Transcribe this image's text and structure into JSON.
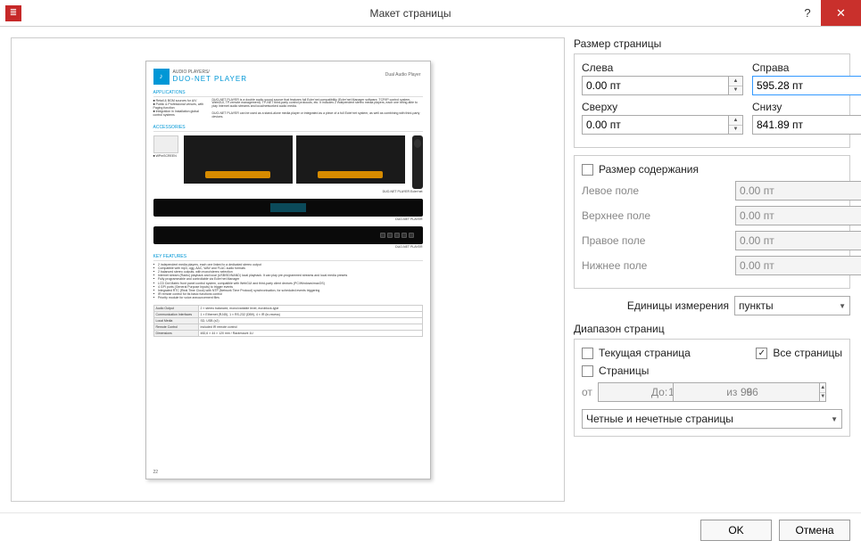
{
  "window": {
    "title": "Макет страницы"
  },
  "page_size": {
    "group_title": "Размер страницы",
    "left_label": "Слева",
    "left_value": "0.00 пт",
    "right_label": "Справа",
    "right_value": "595.28 пт",
    "top_label": "Сверху",
    "top_value": "0.00 пт",
    "bottom_label": "Снизу",
    "bottom_value": "841.89 пт"
  },
  "content_size": {
    "checkbox_label": "Размер содержания",
    "left_margin_label": "Левое поле",
    "left_margin_value": "0.00 пт",
    "top_margin_label": "Верхнее поле",
    "top_margin_value": "0.00 пт",
    "right_margin_label": "Правое поле",
    "right_margin_value": "0.00 пт",
    "bottom_margin_label": "Нижнее поле",
    "bottom_margin_value": "0.00 пт"
  },
  "units": {
    "label": "Единицы измерения",
    "value": "пункты"
  },
  "page_range": {
    "group_title": "Диапазон страниц",
    "current_label": "Текущая страница",
    "all_label": "Все страницы",
    "pages_label": "Страницы",
    "from_label": "от",
    "from_value": "1",
    "to_label": "До:",
    "to_value": "96",
    "of_label": "из : 96",
    "parity_value": "Четные и нечетные страницы"
  },
  "buttons": {
    "ok": "OK",
    "cancel": "Отмена"
  },
  "preview": {
    "category": "AUDIO PLAYERS/",
    "title": "DUO-NET PLAYER",
    "subtitle": "Dual Audio Player",
    "section_applications": "APPLICATIONS",
    "app_bullets": "■ Retail & BGM sources for A/V\n■ Public & Professional venues, with Paging function\n■ Integration in Installation global control systems",
    "app_para": "DUO-NET PLAYER is a double audio sound source that features full Ecler'net compatibility (Ecler'net Manager software, TCP/IP control system, WebGUI, TP-remote management). TP-NET third-party control protocols, etc. It includes 2 independent stereo media players, each one being able to play Internet audio streams and local/networked audio media.\n\nDUO-NET PLAYER can be used as a stand-alone media player or integrated as a piece of a full Ecler'net system, as well as combining with third-party devices.",
    "section_accessories": "ACCESSORIES",
    "accessory_model": "■ WPmSCREEN",
    "caption1": "DUO-NET PLAYER Ecler'net",
    "caption2": "DUO-NET PLAYER",
    "caption3": "DUO-NET PLAYER",
    "section_features": "KEY FEATURES",
    "features": [
      "2 independent media players, each one linked to a dedicated stereo output",
      "Compatible with mp3, ogg, AAC, WAV and FLAC audio formats",
      "2 balanced stereo outputs, with mono/stereo selection",
      "Internet stream (Radio) playback and local (USB/SD/NAND) local playback. It can play pre-programmed streams and local media presets",
      "Fully programmable and controllable via Ecler'net Manager",
      "LCD Dot Matrix front panel control system, compatible with WebGUI and third-party client devices (PC/Windows/macOS)",
      "4 GPI ports (General Purpose Inputs) to trigger events",
      "Integrated RTC (Real Time Clock) with NTP (Network Time Protocol) synchronisation, for scheduled events triggering",
      "IR remote control for its basic functions control",
      "Priority module for voice announcement files"
    ],
    "table": [
      [
        "Audio Output",
        "2 × stereo balanced, mono/variable level, euroblock-type"
      ],
      [
        "Communication Interfaces",
        "1 × Ethernet (RJ45), 1 × RS-232 (DB9), 4 × IR (in-recess)"
      ],
      [
        "Local Media",
        "SD, USB (x2)"
      ],
      [
        "Remote Control",
        "Included IR remote control"
      ],
      [
        "Dimensions",
        "482,6 × 44 × 120 mm / Rackmount 1U"
      ]
    ],
    "page_number": "22"
  }
}
